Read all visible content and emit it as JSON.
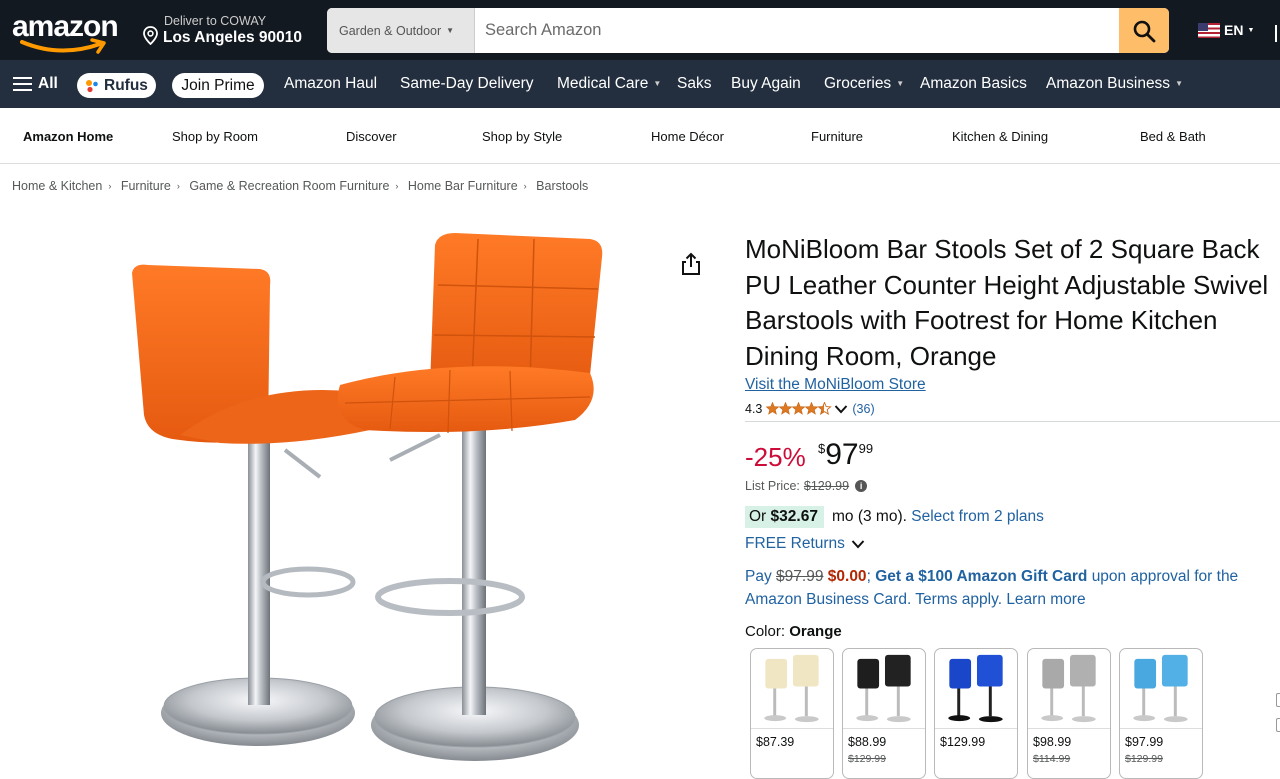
{
  "header": {
    "logo_text": "amazon",
    "deliver_line1": "Deliver to COWAY",
    "deliver_line2": "Los Angeles 90010",
    "search_category": "Garden & Outdoor",
    "search_placeholder": "Search Amazon",
    "language": "EN"
  },
  "nav": {
    "all": "All",
    "rufus": "Rufus",
    "join_prime": "Join Prime",
    "items": [
      "Amazon Haul",
      "Same-Day Delivery",
      "Medical Care",
      "Saks",
      "Buy Again",
      "Groceries",
      "Amazon Basics",
      "Amazon Business"
    ]
  },
  "store_nav": {
    "items": [
      "Amazon Home",
      "Shop by Room",
      "Discover",
      "Shop by Style",
      "Home Décor",
      "Furniture",
      "Kitchen & Dining",
      "Bed & Bath"
    ]
  },
  "breadcrumb": [
    "Home & Kitchen",
    "Furniture",
    "Game & Recreation Room Furniture",
    "Home Bar Furniture",
    "Barstools"
  ],
  "product": {
    "title": "MoNiBloom Bar Stools Set of 2 Square Back PU Leather Counter Height Adjustable Swivel Barstools with Footrest for Home Kitchen Dining Room, Orange",
    "store_link": "Visit the MoNiBloom Store",
    "rating_value": "4.3",
    "rating_stars": 4.3,
    "rating_count": "(36)",
    "discount": "-25%",
    "price_symbol": "$",
    "price_whole": "97",
    "price_fraction": "99",
    "list_price_label": "List Price:",
    "list_price": "$129.99",
    "monthly_or": "Or",
    "monthly_amount": "$32.67",
    "monthly_term": "mo (3 mo).",
    "monthly_plans": "Select from 2 plans",
    "returns": "FREE Returns",
    "card_pay": "Pay",
    "card_old": "$97.99",
    "card_new": "$0.00",
    "card_gift": "Get a $100 Amazon Gift Card",
    "card_rest": "upon approval for the Amazon Business Card. Terms apply. Learn more",
    "color_label": "Color:",
    "color_value": "Orange",
    "primary_color": "#f26a1e"
  },
  "swatches": [
    {
      "color": "#f1e6c4",
      "price": "$87.39",
      "old": ""
    },
    {
      "color": "#1e1e1e",
      "price": "$88.99",
      "old": "$129.99"
    },
    {
      "color": "#1a47c9",
      "price": "$129.99",
      "old": ""
    },
    {
      "color": "#a9a9a9",
      "price": "$98.99",
      "old": "$114.99"
    },
    {
      "color": "#4aa8e0",
      "price": "$97.99",
      "old": "$129.99"
    }
  ]
}
